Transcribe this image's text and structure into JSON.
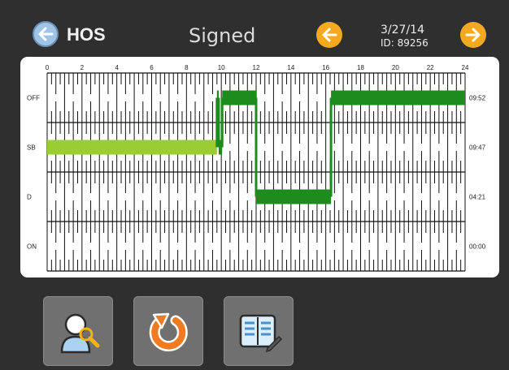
{
  "header": {
    "title": "HOS",
    "status": "Signed",
    "date": "3/27/14",
    "record_id": "ID: 89256",
    "icons": {
      "back": "arrow-left-icon",
      "prev": "arrow-left-icon",
      "next": "arrow-right-icon"
    },
    "colors": {
      "back_button": "#9fc4e8",
      "nav_button": "#f5a91f"
    }
  },
  "chart_data": {
    "type": "line",
    "xlabel": "",
    "ylabel": "",
    "x_ticks": [
      "0",
      "2",
      "4",
      "6",
      "8",
      "10",
      "12",
      "14",
      "16",
      "18",
      "20",
      "22",
      "24"
    ],
    "xlim": [
      0,
      24
    ],
    "rows": [
      "OFF",
      "SB",
      "D",
      "ON"
    ],
    "row_totals": [
      "09:52",
      "09:47",
      "04:21",
      "00:00"
    ],
    "segments": [
      {
        "status": "SB",
        "start": 0,
        "end": 9.75,
        "color": "#9acd32"
      },
      {
        "status": "OFF",
        "start": 9.75,
        "end": 9.85,
        "color": "#1e8b1e"
      },
      {
        "status": "SB",
        "start": 9.85,
        "end": 10.05,
        "color": "#1e8b1e"
      },
      {
        "status": "OFF",
        "start": 10.05,
        "end": 12.0,
        "color": "#1e8b1e"
      },
      {
        "status": "D",
        "start": 12.0,
        "end": 16.3,
        "color": "#1e8b1e"
      },
      {
        "status": "OFF",
        "start": 16.3,
        "end": 24.0,
        "color": "#1e8b1e"
      }
    ],
    "grid": true
  },
  "actions": [
    {
      "id": "driver-lookup",
      "icon": "user-search-icon"
    },
    {
      "id": "refresh",
      "icon": "refresh-icon"
    },
    {
      "id": "log-notes",
      "icon": "notebook-edit-icon"
    }
  ]
}
